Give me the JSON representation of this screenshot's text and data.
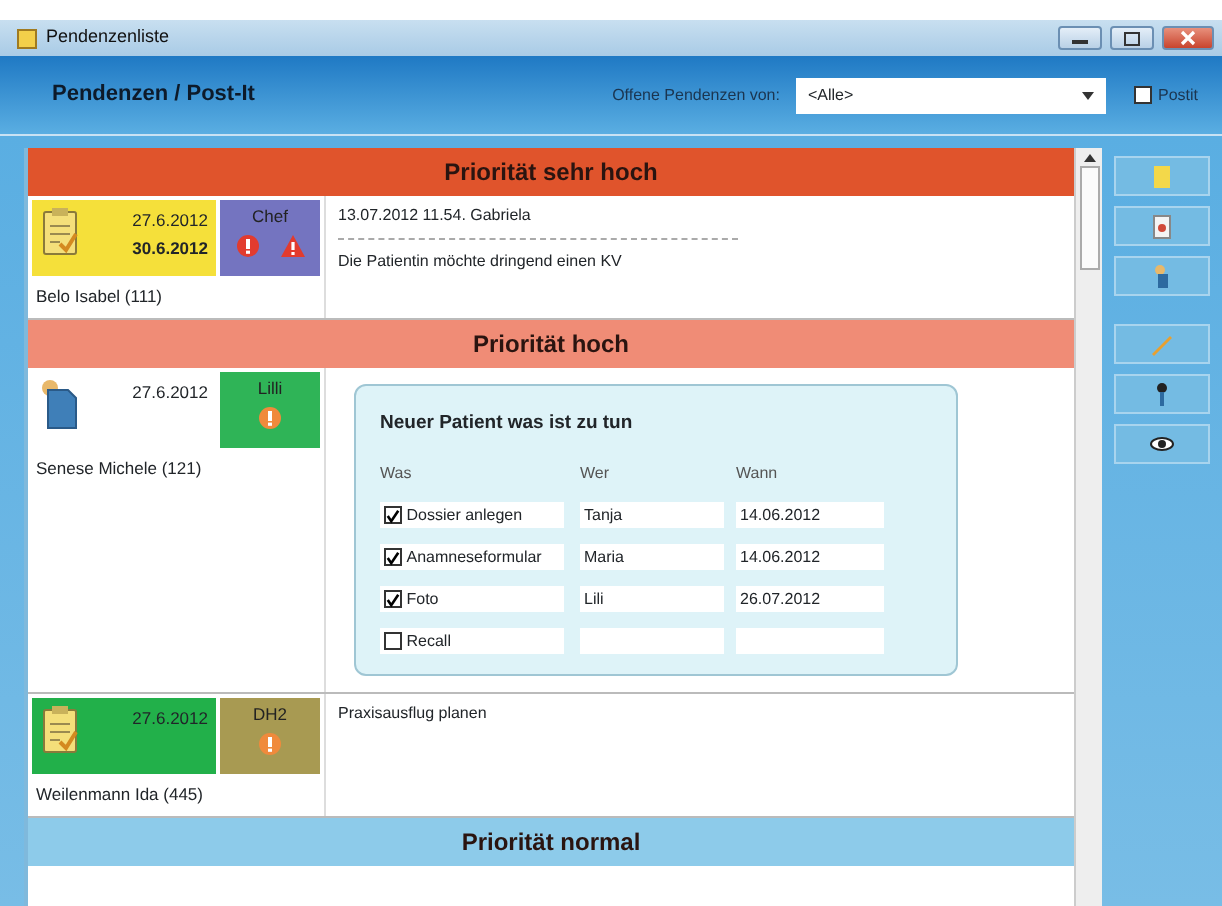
{
  "window": {
    "title": "Pendenzenliste"
  },
  "header": {
    "title": "Pendenzen / Post-It",
    "filter_label": "Offene Pendenzen von:",
    "filter_value": "<Alle>",
    "postit_label": "Postit",
    "postit_checked": false
  },
  "sections": [
    {
      "title": "Priorität sehr hoch",
      "color": "#e0542c",
      "items": [
        {
          "kind": "note",
          "date": "27.6.2012",
          "due_date": "30.6.2012",
          "color": "#f5e03a",
          "badge": {
            "label": "Chef",
            "color": "#7474c0",
            "alerts": [
              {
                "kind": "exclamation",
                "color": "#e23b2e"
              },
              {
                "kind": "warning",
                "color": "#e23b2e"
              }
            ]
          },
          "patient": "Belo Isabel (111)",
          "message": [
            "13.07.2012 11.54. Gabriela",
            "Die Patientin möchte dringend einen KV"
          ]
        }
      ]
    },
    {
      "title": "Priorität hoch",
      "color": "#f08c76",
      "items": [
        {
          "kind": "document",
          "date": "27.6.2012",
          "color": "#ffffff",
          "badge": {
            "label": "Lilli",
            "color": "#2fb457",
            "alerts": [
              {
                "kind": "exclamation",
                "color": "#f08a3c"
              }
            ]
          },
          "patient": "Senese Michele (121)",
          "checklist": {
            "title": "Neuer Patient was ist zu tun",
            "columns": [
              "Was",
              "Wer",
              "Wann"
            ],
            "rows": [
              {
                "checked": true,
                "task": "Dossier anlegen",
                "who": "Tanja",
                "when": "14.06.2012"
              },
              {
                "checked": true,
                "task": "Anamneseformular",
                "who": "Maria",
                "when": "14.06.2012"
              },
              {
                "checked": true,
                "task": "Foto",
                "who": "Lili",
                "when": "26.07.2012"
              },
              {
                "checked": false,
                "task": "Recall"
              }
            ]
          }
        },
        {
          "kind": "note",
          "date": "27.6.2012",
          "color": "#22b04a",
          "badge": {
            "label": "DH2",
            "color": "#a89a52",
            "alerts": [
              {
                "kind": "exclamation",
                "color": "#f08a3c"
              }
            ]
          },
          "patient": "Weilenmann Ida (445)",
          "message": [
            "Praxisausflug planen"
          ]
        }
      ]
    },
    {
      "title": "Priorität normal",
      "color": "#8dcbea"
    }
  ]
}
